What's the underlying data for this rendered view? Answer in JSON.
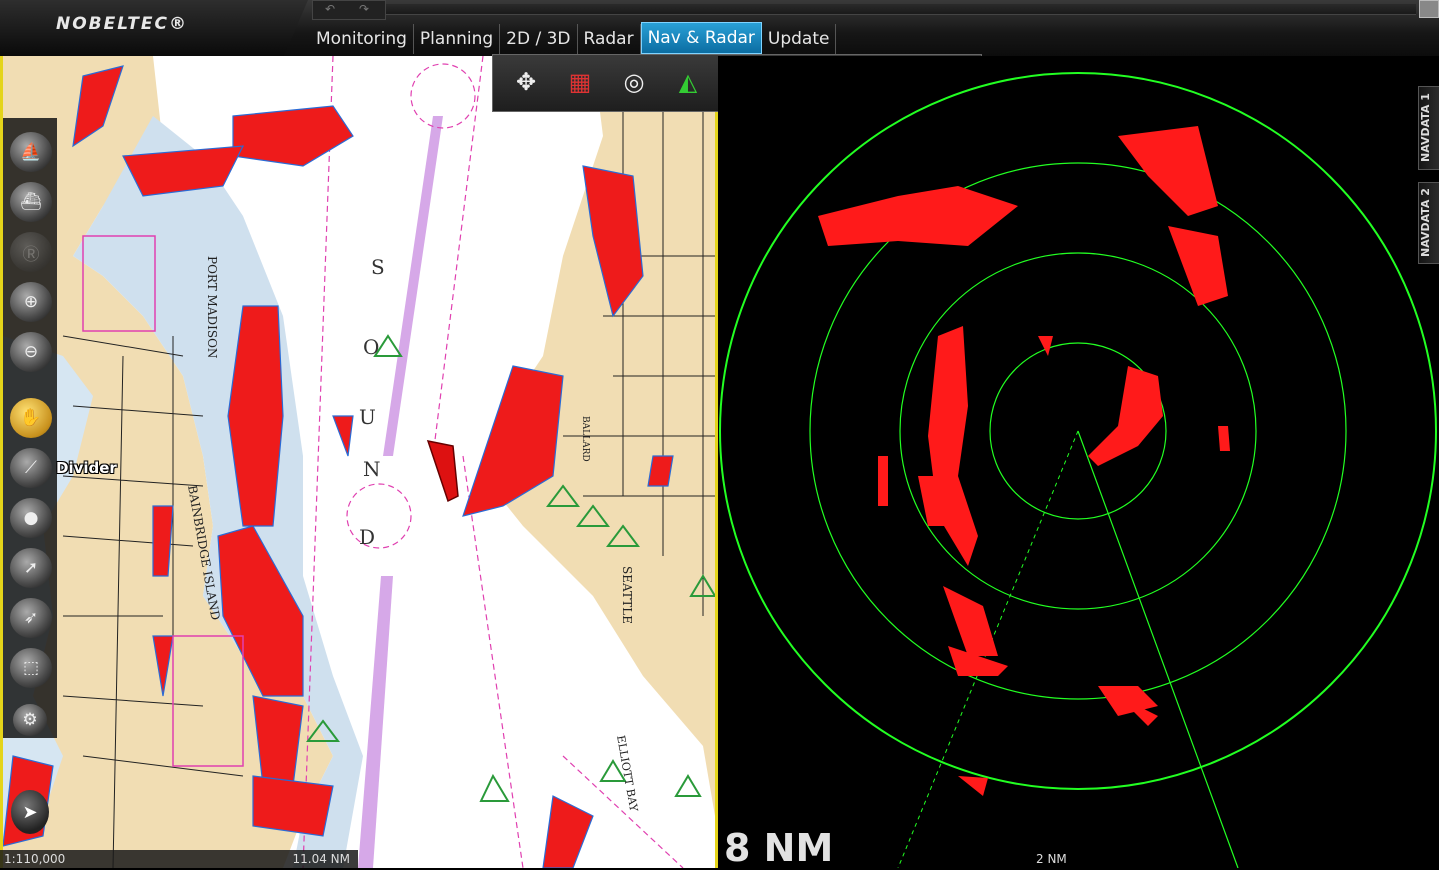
{
  "app": {
    "logo": "NOBELTEC®"
  },
  "tabs": [
    {
      "label": "Monitoring",
      "active": false
    },
    {
      "label": "Planning",
      "active": false
    },
    {
      "label": "2D / 3D",
      "active": false
    },
    {
      "label": "Radar",
      "active": false
    },
    {
      "label": "Nav & Radar",
      "active": true
    },
    {
      "label": "Update",
      "active": false
    }
  ],
  "toolbar": {
    "divider_label": "Divider",
    "tools": [
      "boat-center",
      "boat-heading",
      "route-r",
      "zoom-in",
      "zoom-out",
      "pan-hand",
      "divider",
      "mark",
      "cursor-info",
      "cursor-select",
      "area-select"
    ]
  },
  "chart": {
    "scale": "1:110,000",
    "distance": "11.04 NM",
    "labels": {
      "port_madison": "PORT MADISON",
      "bainbridge": "BAINBRIDGE ISLAND",
      "seattle": "SEATTLE",
      "ballard": "BALLARD",
      "elliott_bay": "ELLIOTT BAY",
      "sound": [
        "S",
        "O",
        "U",
        "N",
        "D"
      ]
    }
  },
  "iconbar": [
    "compass-rose-icon",
    "chart-map-icon",
    "radar-target-icon",
    "ais-target-icon",
    "track-icon",
    "weather-icon",
    "flag-list-icon",
    "waypoint-flags-icon",
    "settings-gear-icon"
  ],
  "radar": {
    "range": "8 NM",
    "ring_spacing": "2 NM",
    "colors": {
      "echo": "#ff1a1a",
      "ring": "#22ff22",
      "background": "#000000"
    }
  },
  "navdata": [
    "NAVDATA 1",
    "NAVDATA 2"
  ]
}
